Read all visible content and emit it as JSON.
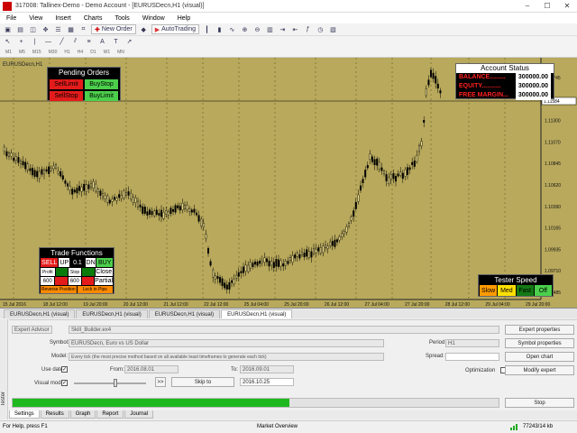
{
  "window": {
    "title": "317008: Tallinex-Demo - Demo Account - [EURUSDecn,H1 (visual)]",
    "controls": [
      "–",
      "☐",
      "✕"
    ]
  },
  "menu": [
    "File",
    "View",
    "Insert",
    "Charts",
    "Tools",
    "Window",
    "Help"
  ],
  "toolbar": {
    "new_order": "New Order",
    "autotrading": "AutoTrading"
  },
  "timeframes": [
    "M1",
    "M5",
    "M15",
    "M30",
    "H1",
    "H4",
    "D1",
    "W1",
    "MN"
  ],
  "chart": {
    "symbol_label": "EURUSDecn,H1",
    "colors": {
      "background": "#b8a95c",
      "bull": "#000000",
      "bear": "#000000",
      "grid": "#8a7b3a",
      "line": "#000000"
    },
    "price_labels": [
      "1.11745",
      "1.11525",
      "1.11300",
      "1.11070",
      "1.10845",
      "1.10620",
      "1.10390",
      "1.10165",
      "1.09935",
      "1.09710",
      "1.09485"
    ],
    "current_price": "1.11584",
    "date_labels": [
      "15 Jul 2016",
      "18 Jul 12:00",
      "19 Jul 20:00",
      "20 Jul 12:00",
      "21 Jul 12:00",
      "22 Jul 12:00",
      "25 Jul 04:00",
      "25 Jul 20:00",
      "26 Jul 12:00",
      "27 Jul 04:00",
      "27 Jul 20:00",
      "28 Jul 12:00",
      "29 Jul 04:00",
      "29 Jul 20:00"
    ]
  },
  "pending_orders": {
    "title": "Pending Orders",
    "buttons": [
      "SellLimit",
      "BuyStop",
      "SellStop",
      "BuyLimit"
    ]
  },
  "account_status": {
    "title": "Account Status",
    "rows": [
      {
        "label": "BALANCE.........",
        "value": "300000.00"
      },
      {
        "label": "EQUITY...........",
        "value": "300000.00"
      },
      {
        "label": "FREE MARGIN...",
        "value": "300000.00"
      }
    ]
  },
  "trade_functions": {
    "title": "Trade Functions",
    "sell": "SELL",
    "up": "UP",
    "lot": "0.1",
    "dn": "DN",
    "buy": "BUY",
    "profit": "Profit",
    "stop": "Stop",
    "close": "Close",
    "profit_val": "600",
    "stop_val": "600",
    "partial": "Partial",
    "reverse": "Reverse Position",
    "lock": "Lock in Pips"
  },
  "tester_speed": {
    "title": "Tester Speed",
    "buttons": [
      "Slow",
      "Med",
      "Fast",
      "Off"
    ]
  },
  "chart_tabs": [
    "EURUSDecn,H1 (visual)",
    "EURUSDecn,H1 (visual)",
    "EURUSDecn,H1 (visual)",
    "EURUSDecn,H1 (visual)"
  ],
  "tester": {
    "mode": "Expert Advisor",
    "ea": "Skill_Builder.ex4",
    "symbol_label": "Symbol:",
    "symbol": "EURUSDecn, Euro vs US Dollar",
    "model_label": "Model:",
    "model": "Every tick (the most precise method based on all available least timeframes to generate each tick)",
    "use_date_label": "Use date",
    "from_label": "From:",
    "from": "2016.08.01",
    "to_label": "To:",
    "to": "2016.09.01",
    "visual_label": "Visual mode",
    "skip_label": "Skip to",
    "skip_date": "2016.10.25",
    "period_label": "Period:",
    "period": "H1",
    "spread_label": "Spread:",
    "optimization_label": "Optimization",
    "expert_properties": "Expert properties",
    "symbol_properties": "Symbol properties",
    "open_chart": "Open chart",
    "modify_expert": "Modify expert",
    "stop": "Stop",
    "progress": 0.57,
    "progress_color": "#1fb81f",
    "pause_glyph": ">>"
  },
  "sidebar_label": "Tester",
  "bottom_tabs": [
    "Settings",
    "Results",
    "Graph",
    "Report",
    "Journal"
  ],
  "status": {
    "help": "For Help, press F1",
    "market": "Market Overview",
    "traffic": "77243/14 kb"
  }
}
